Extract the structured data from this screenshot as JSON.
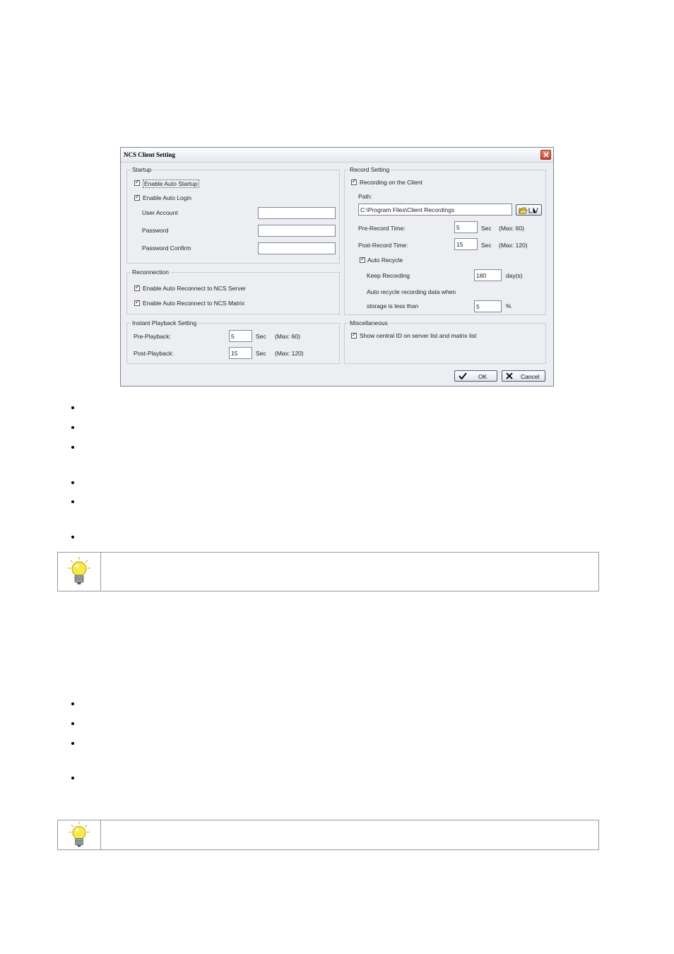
{
  "dialog": {
    "title": "NCS Client Setting",
    "icons": {
      "close": "close-icon",
      "browse": "folder-open-icon",
      "ok": "checkmark-icon",
      "cancel": "x-icon"
    },
    "startup": {
      "title": "Startup",
      "enable_auto_startup": {
        "label": "Enable Auto Startup",
        "checked": true
      },
      "enable_auto_login": {
        "label": "Enable Auto Login",
        "checked": true
      },
      "user_account_label": "User Account",
      "user_account_value": "",
      "password_label": "Password",
      "password_value": "",
      "password_confirm_label": "Password Confirm",
      "password_confirm_value": ""
    },
    "reconnection": {
      "title": "Reconnection",
      "ncs_server": {
        "label": "Enable Auto Reconnect to NCS Server",
        "checked": true
      },
      "ncs_matrix": {
        "label": "Enable Auto Reconnect to NCS Matrix",
        "checked": true
      }
    },
    "instant_playback": {
      "title": "Instant Playback Setting",
      "pre_label": "Pre-Playback:",
      "pre_value": "5",
      "pre_unit": "Sec",
      "pre_max": "(Max: 60)",
      "post_label": "Post-Playback:",
      "post_value": "15",
      "post_unit": "Sec",
      "post_max": "(Max: 120)"
    },
    "record": {
      "title": "Record Setting",
      "recording_on_client": {
        "label": "Recording on the Client",
        "checked": true
      },
      "path_label": "Path:",
      "path_value": "C:\\Program Files\\Client Recordings",
      "pre_record_label": "Pre-Record Time:",
      "pre_record_value": "5",
      "pre_record_unit": "Sec",
      "pre_record_max": "(Max: 60)",
      "post_record_label": "Post-Record Time:",
      "post_record_value": "15",
      "post_record_unit": "Sec",
      "post_record_max": "(Max: 120)",
      "auto_recycle": {
        "label": "Auto Recycle",
        "checked": true
      },
      "keep_recording_label": "Keep Recording",
      "keep_recording_value": "180",
      "keep_recording_unit": "day(s)",
      "recycle_text_1": "Auto recycle recording data when",
      "recycle_text_2": "storage is less than",
      "storage_value": "5",
      "storage_unit": "%"
    },
    "misc": {
      "title": "Miscellaneous",
      "show_central_id": {
        "label": "Show central ID on server list and matrix list",
        "checked": true
      }
    },
    "ok_label": "OK",
    "cancel_label": "Cancel"
  },
  "document": {
    "note_icon": "lightbulb-icon"
  }
}
